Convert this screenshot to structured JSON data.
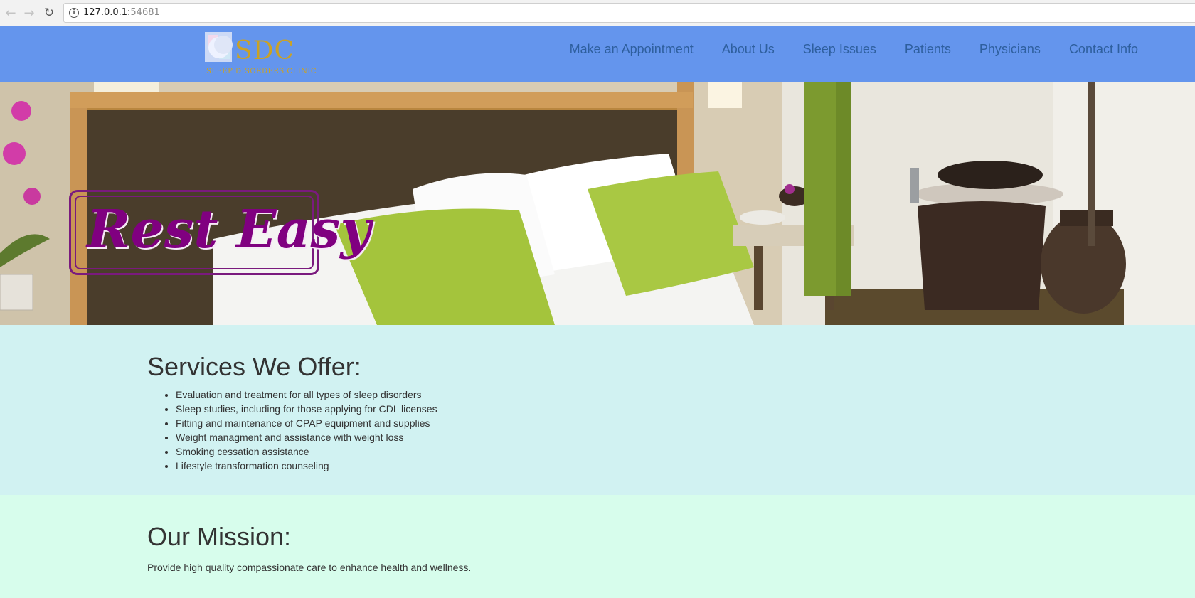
{
  "browser": {
    "url_host": "127.0.0.1:",
    "url_port": "54681"
  },
  "header": {
    "logo_text": "SDC",
    "logo_subtitle": "SLEEP DISORDERS CLINIC",
    "nav": [
      {
        "label": "Make an Appointment"
      },
      {
        "label": "About Us"
      },
      {
        "label": "Sleep Issues"
      },
      {
        "label": "Patients"
      },
      {
        "label": "Physicians"
      },
      {
        "label": "Contact Info"
      }
    ],
    "bg_color": "#6495ed"
  },
  "hero": {
    "badge_text": "Rest Easy",
    "badge_color": "#800080"
  },
  "services": {
    "heading": "Services We Offer:",
    "items": [
      "Evaluation and treatment for all types of sleep disorders",
      "Sleep studies, including for those applying for CDL licenses",
      "Fitting and maintenance of CPAP equipment and supplies",
      "Weight managment and assistance with weight loss",
      "Smoking cessation assistance",
      "Lifestyle transformation counseling"
    ]
  },
  "mission": {
    "heading": "Our Mission:",
    "text": "Provide high quality compassionate care to enhance health and wellness."
  }
}
